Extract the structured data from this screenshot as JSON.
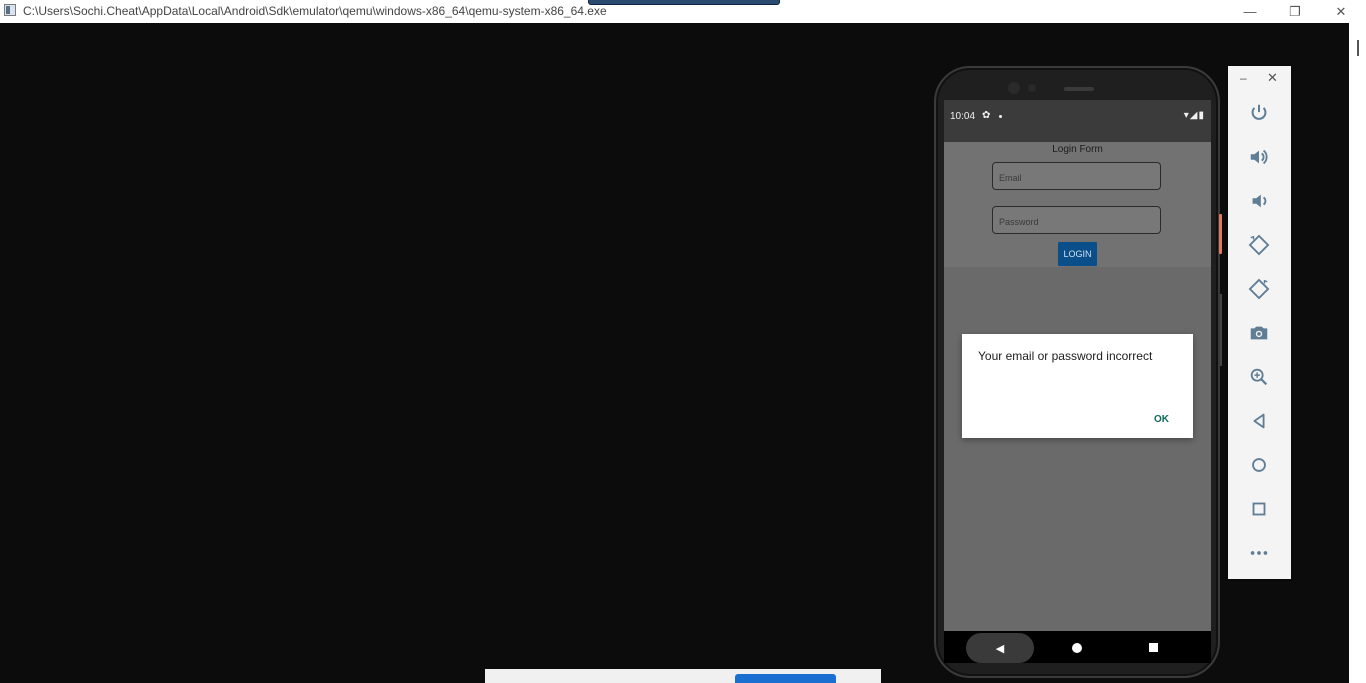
{
  "window": {
    "title": "C:\\Users\\Sochi.Cheat\\AppData\\Local\\Android\\Sdk\\emulator\\qemu\\windows-x86_64\\qemu-system-x86_64.exe",
    "minimize_glyph": "—",
    "maximize_glyph": "❐",
    "close_glyph": "✕"
  },
  "statusbar": {
    "time": "10:04",
    "settings_glyph": "✿",
    "right_icons": "▾◢▮"
  },
  "app": {
    "form_title": "Login Form",
    "email_placeholder": "Email",
    "password_placeholder": "Password",
    "login_label": "LOGIN"
  },
  "dialog": {
    "message": "Your email or password incorrect",
    "ok_label": "OK"
  },
  "navbar": {
    "back_glyph": "◀"
  },
  "toolbar": {
    "minimize_glyph": "–",
    "close_glyph": "✕",
    "buttons": [
      "power-icon",
      "volume-up-icon",
      "volume-down-icon",
      "rotate-left-icon",
      "rotate-right-icon",
      "camera-icon",
      "zoom-icon",
      "back-icon",
      "home-icon",
      "overview-icon",
      "more-icon"
    ]
  },
  "colors": {
    "login_button": "#0b4f8a",
    "dialog_ok": "#0e6a5a",
    "toolbar_icon": "#5f7d95"
  }
}
